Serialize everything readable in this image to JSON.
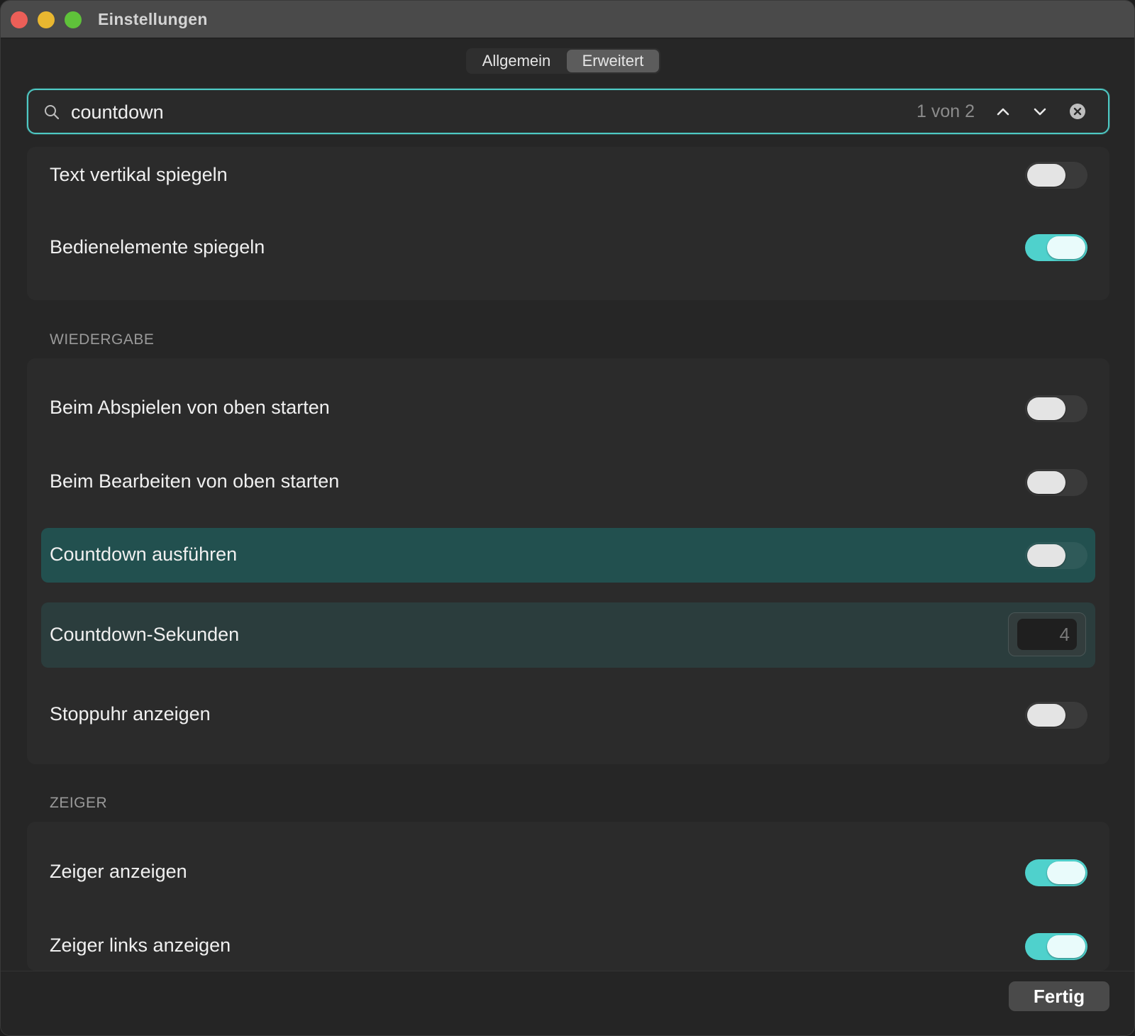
{
  "window": {
    "title": "Einstellungen"
  },
  "tabs": [
    {
      "label": "Allgemein",
      "selected": false
    },
    {
      "label": "Erweitert",
      "selected": true
    }
  ],
  "search": {
    "value": "countdown",
    "placeholder": "",
    "match_count": "1 von 2"
  },
  "groups": {
    "top": {
      "rows": [
        {
          "label": "Text vertikal spiegeln",
          "type": "toggle",
          "on": false
        },
        {
          "label": "Bedienelemente spiegeln",
          "type": "toggle",
          "on": true
        }
      ]
    },
    "wiedergabe": {
      "header": "WIEDERGABE",
      "rows": [
        {
          "label": "Beim Abspielen von oben starten",
          "type": "toggle",
          "on": false
        },
        {
          "label": "Beim Bearbeiten von oben starten",
          "type": "toggle",
          "on": false
        },
        {
          "label": "Countdown ausführen",
          "type": "toggle",
          "on": false,
          "highlight": "current"
        },
        {
          "label": "Countdown-Sekunden",
          "type": "number",
          "value": "4",
          "highlight": "match"
        },
        {
          "label": "Stoppuhr anzeigen",
          "type": "toggle",
          "on": false
        }
      ]
    },
    "zeiger": {
      "header": "ZEIGER",
      "rows": [
        {
          "label": "Zeiger anzeigen",
          "type": "toggle",
          "on": true
        },
        {
          "label": "Zeiger links anzeigen",
          "type": "toggle",
          "on": true
        }
      ]
    }
  },
  "footer": {
    "done_label": "Fertig"
  },
  "colors": {
    "accent": "#4fd1cc",
    "highlight_current": "#22504f",
    "highlight_match": "#2b3d3d"
  },
  "icons": [
    "search-icon",
    "chevron-up-icon",
    "chevron-down-icon",
    "clear-icon"
  ]
}
